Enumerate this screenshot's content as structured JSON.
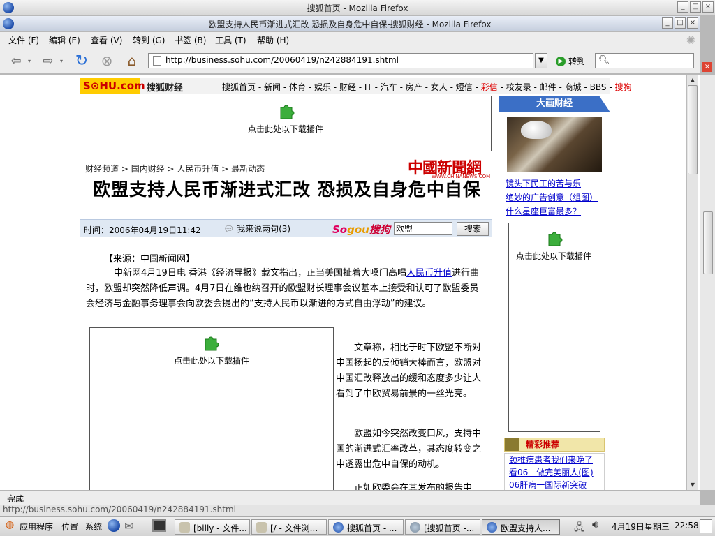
{
  "outer_window": {
    "title": "搜狐首页 - Mozilla Firefox"
  },
  "inner_window": {
    "title": "欧盟支持人民币渐进式汇改 恐损及自身危中自保-搜狐财经 - Mozilla Firefox"
  },
  "window_buttons": {
    "minimize": "_",
    "maximize": "□",
    "close": "×"
  },
  "menu": {
    "file": "文件 (F)",
    "edit": "编辑 (E)",
    "view": "查看 (V)",
    "go": "转到 (G)",
    "bookmarks": "书签 (B)",
    "tools": "工具 (T)",
    "help": "帮助 (H)"
  },
  "toolbar": {
    "url": "http://business.sohu.com/20060419/n242884191.shtml",
    "go_label": "转到"
  },
  "site": {
    "logo": "S⊙HU.com",
    "channel": "搜狐财经",
    "nav": [
      "搜狐首页",
      "新闻",
      "体育",
      "娱乐",
      "财经",
      "IT",
      "汽车",
      "房产",
      "女人",
      "短信",
      "彩信",
      "校友录",
      "邮件",
      "商城",
      "BBS",
      "搜狗"
    ],
    "nav_red": [
      "彩信",
      "搜狗"
    ]
  },
  "plugin_text": "点击此处以下载插件",
  "breadcrumb": [
    "财经频道",
    "国内财经",
    "人民币升值",
    "最新动态"
  ],
  "breadcrumb_sep": ">",
  "chinanews": {
    "name": "中國新聞網",
    "url": "WWW.CHINANEWS.COM"
  },
  "article": {
    "headline": "欧盟支持人民币渐进式汇改 恐损及自身危中自保",
    "time": "时间：2006年04月19日11:42",
    "comment": "我来说两句(3)",
    "sogou": "Sogou搜狗",
    "search_value": "欧盟",
    "search_button": "搜索",
    "source": "【来源：中国新闻网】",
    "para1_before": "中新网4月19日电 香港《经济导报》载文指出，正当美国扯着大嗓门高唱",
    "para1_link": "人民币升值",
    "para1_after": "进行曲时，欧盟却突然降低声调。4月7日在维也纳召开的欧盟财长理事会议基本上接受和认可了欧盟委员会经济与金融事务理事会向欧委会提出的“支持人民币以渐进的方式自由浮动”的建议。",
    "para2": "文章称，相比于时下欧盟不断对中国扬起的反倾销大棒而言，欧盟对中国汇改释放出的缓和态度多少让人看到了中欧贸易前景的一丝光亮。",
    "para3": "欧盟如今突然改变口风，支持中国的渐进式汇率改革，其态度转变之中透露出危中自保的动机。",
    "para4": "正如欧委会在其发布的报告中"
  },
  "sidebar": {
    "title": "大画财经",
    "links": [
      "镜头下民工的苦与乐",
      "绝妙的广告创意（组图）",
      "什么星座巨富最多？"
    ],
    "rec_title": "精彩推荐",
    "rec_links": [
      "颈椎病患者我们来晚了",
      "看06一做完美丽人(图)",
      "06肝病一国际新突破"
    ]
  },
  "status": {
    "text": "完成",
    "hover_url": "http://business.sohu.com/20060419/n242884191.shtml"
  },
  "taskbar": {
    "apps": "应用程序",
    "places": "位置",
    "system": "系统",
    "buttons": [
      "[billy - 文件...",
      "[/ - 文件浏...",
      "搜狐首页 - ...",
      "[搜狐首页 -...",
      "欧盟支持人..."
    ],
    "clock_date": "4月19日星期三",
    "clock_time": "22:58"
  },
  "colors": {
    "sohu_yellow": "#ffcc00",
    "sohu_red": "#dd0000",
    "link_blue": "#0000cc",
    "sidebar_blue": "#3b6fc6"
  }
}
